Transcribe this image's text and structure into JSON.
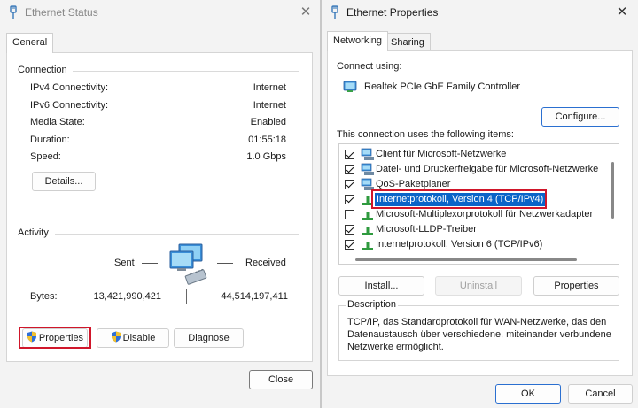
{
  "status_window": {
    "title": "Ethernet Status",
    "tab_general": "General",
    "connection_label": "Connection",
    "rows": [
      {
        "label": "IPv4 Connectivity:",
        "value": "Internet"
      },
      {
        "label": "IPv6 Connectivity:",
        "value": "Internet"
      },
      {
        "label": "Media State:",
        "value": "Enabled"
      },
      {
        "label": "Duration:",
        "value": "01:55:18"
      },
      {
        "label": "Speed:",
        "value": "1.0 Gbps"
      }
    ],
    "details_button": "Details...",
    "activity_label": "Activity",
    "sent_label": "Sent",
    "received_label": "Received",
    "bytes_label": "Bytes:",
    "bytes_sent": "13,421,990,421",
    "bytes_received": "44,514,197,411",
    "properties_button": "Properties",
    "disable_button": "Disable",
    "diagnose_button": "Diagnose",
    "close_button": "Close"
  },
  "properties_window": {
    "title": "Ethernet Properties",
    "tab_networking": "Networking",
    "tab_sharing": "Sharing",
    "connect_using_label": "Connect using:",
    "adapter_name": "Realtek PCIe GbE Family Controller",
    "configure_button": "Configure...",
    "items_label": "This connection uses the following items:",
    "items": [
      {
        "label": "Client für Microsoft-Netzwerke",
        "checked": true,
        "icon": "network-client-icon"
      },
      {
        "label": "Datei- und Druckerfreigabe für Microsoft-Netzwerke",
        "checked": true,
        "icon": "file-share-icon"
      },
      {
        "label": "QoS-Paketplaner",
        "checked": true,
        "icon": "qos-icon"
      },
      {
        "label": "Internetprotokoll, Version 4 (TCP/IPv4)",
        "checked": true,
        "icon": "protocol-icon",
        "selected": true
      },
      {
        "label": "Microsoft-Multiplexorprotokoll für Netzwerkadapter",
        "checked": false,
        "icon": "protocol-icon"
      },
      {
        "label": "Microsoft-LLDP-Treiber",
        "checked": true,
        "icon": "protocol-icon"
      },
      {
        "label": "Internetprotokoll, Version 6 (TCP/IPv6)",
        "checked": true,
        "icon": "protocol-icon"
      }
    ],
    "install_button": "Install...",
    "uninstall_button": "Uninstall",
    "properties_button": "Properties",
    "description_label": "Description",
    "description_text_1": "TCP/IP, das Standardprotokoll für WAN-Netzwerke, das den",
    "description_text_2": "Datenaustausch über verschiedene, miteinander verbundene",
    "description_text_3": "Netzwerke ermöglicht.",
    "ok_button": "OK",
    "cancel_button": "Cancel"
  },
  "colors": {
    "highlight": "#d0162a",
    "selection": "#0a64c8"
  }
}
